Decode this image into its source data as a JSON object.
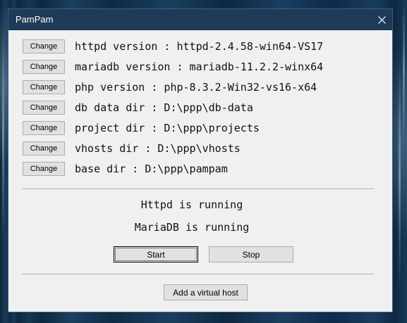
{
  "window": {
    "title": "PamPam",
    "close_glyph": "×"
  },
  "settings": {
    "change_label": "Change",
    "items": [
      {
        "label": "httpd version : httpd-2.4.58-win64-VS17"
      },
      {
        "label": "mariadb version : mariadb-11.2.2-winx64"
      },
      {
        "label": "php version : php-8.3.2-Win32-vs16-x64"
      },
      {
        "label": "db data dir : D:\\ppp\\db-data"
      },
      {
        "label": "project dir : D:\\ppp\\projects"
      },
      {
        "label": "vhosts dir : D:\\ppp\\vhosts"
      },
      {
        "label": "base dir : D:\\ppp\\pampam"
      }
    ]
  },
  "status": {
    "httpd": "Httpd is running",
    "mariadb": "MariaDB is running"
  },
  "controls": {
    "start_label": "Start",
    "stop_label": "Stop",
    "add_vhost_label": "Add a virtual host"
  },
  "colors": {
    "titlebar": "#1e3a57",
    "window_bg": "#f0f0f0",
    "button_bg": "#e1e1e1"
  },
  "icons": {
    "close": "close-icon"
  }
}
